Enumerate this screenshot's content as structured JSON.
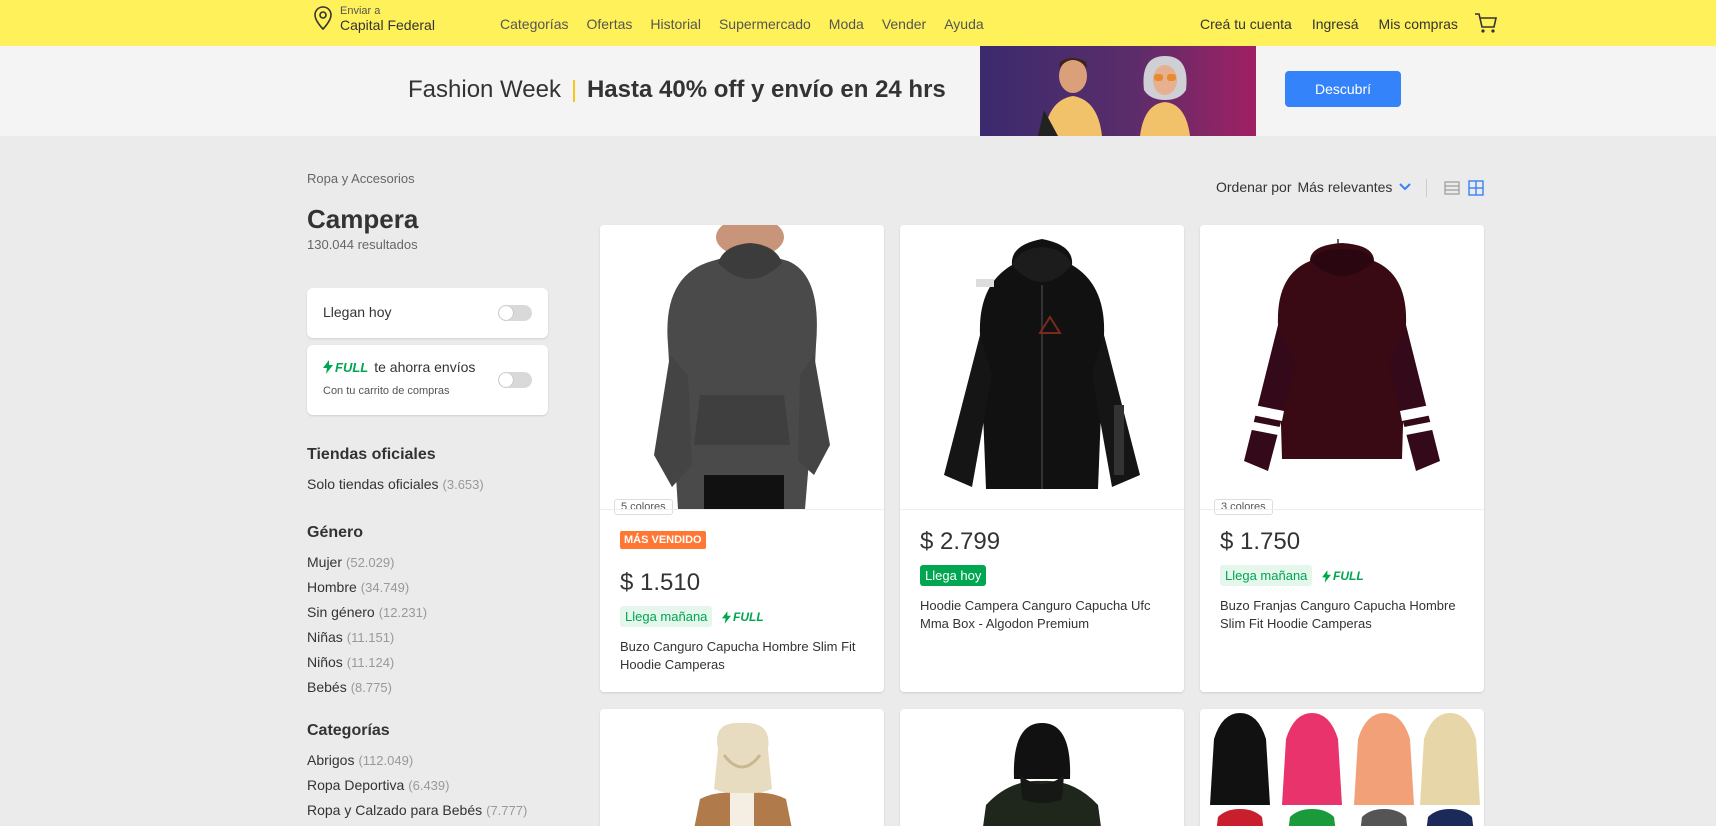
{
  "header": {
    "location_small": "Enviar a",
    "location_city": "Capital Federal",
    "nav": [
      "Categorías",
      "Ofertas",
      "Historial",
      "Supermercado",
      "Moda",
      "Vender",
      "Ayuda"
    ],
    "right_nav": [
      "Creá tu cuenta",
      "Ingresá",
      "Mis compras"
    ]
  },
  "banner": {
    "left_text": "Fashion Week",
    "bold_text": "Hasta 40% off y envío en 24 hrs",
    "button": "Descubrí"
  },
  "breadcrumb": "Ropa y Accesorios",
  "search_title": "Campera",
  "results": "130.044 resultados",
  "filters": {
    "today_label": "Llegan hoy",
    "full_label": "FULL",
    "full_text": "te ahorra envíos",
    "full_sub": "Con tu carrito de compras"
  },
  "sections": {
    "official": {
      "title": "Tiendas oficiales",
      "items": [
        {
          "label": "Solo tiendas oficiales",
          "count": "(3.653)"
        }
      ]
    },
    "gender": {
      "title": "Género",
      "items": [
        {
          "label": "Mujer",
          "count": "(52.029)"
        },
        {
          "label": "Hombre",
          "count": "(34.749)"
        },
        {
          "label": "Sin género",
          "count": "(12.231)"
        },
        {
          "label": "Niñas",
          "count": "(11.151)"
        },
        {
          "label": "Niños",
          "count": "(11.124)"
        },
        {
          "label": "Bebés",
          "count": "(8.775)"
        }
      ]
    },
    "categories": {
      "title": "Categorías",
      "items": [
        {
          "label": "Abrigos",
          "count": "(112.049)"
        },
        {
          "label": "Ropa Deportiva",
          "count": "(6.439)"
        },
        {
          "label": "Ropa y Calzado para Bebés",
          "count": "(7.777)"
        }
      ]
    }
  },
  "sort": {
    "label": "Ordenar por",
    "value": "Más relevantes"
  },
  "products": [
    {
      "colors": "5 colores",
      "badge": "MÁS VENDIDO",
      "price": "$ 1.510",
      "shipping": "Llega mañana",
      "full": "FULL",
      "title": "Buzo Canguro Capucha Hombre Slim Fit Hoodie Camperas",
      "color": "#4a4a4a"
    },
    {
      "price": "$ 2.799",
      "shipping": "Llega hoy",
      "title": "Hoodie Campera Canguro Capucha Ufc Mma Box - Algodon Premium",
      "color": "#111111"
    },
    {
      "colors": "3 colores",
      "price": "$ 1.750",
      "shipping": "Llega mañana",
      "full": "FULL",
      "title": "Buzo Franjas Canguro Capucha Hombre Slim Fit Hoodie Camperas",
      "color": "#3a0a14"
    }
  ]
}
